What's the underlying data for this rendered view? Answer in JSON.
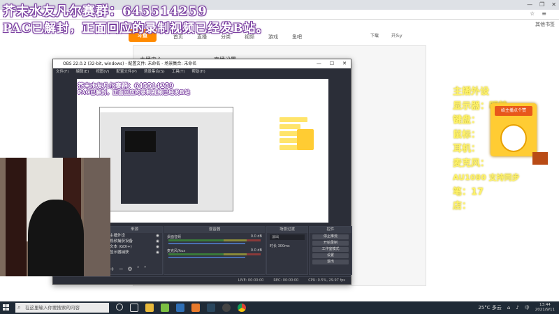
{
  "overlay": {
    "line1": "芥末水友凡尔赛群：645514259",
    "line2": "PAC已解封，正面回应的录制视频已经发B站。"
  },
  "browser": {
    "window_controls": [
      "—",
      "❐",
      "✕"
    ],
    "addr_icons": [
      "☆",
      "≡"
    ],
    "bookmarks_label": "其他书签",
    "site_logo": "斗鱼",
    "nav": [
      "首页",
      "直播",
      "分类",
      "视频",
      "游戏",
      "鱼吧"
    ],
    "nav_right": [
      "下载",
      "开头y"
    ],
    "panel_title": "主播中心",
    "panel_title2": "直播设置"
  },
  "info": {
    "lines": [
      "主播外设",
      "显示器：明基",
      "键盘：",
      "鼠标：",
      "耳机：",
      "麦克风：",
      "AU1080  支持同步",
      "笔：17",
      "店："
    ],
    "badge_caption": "给主播点个赞"
  },
  "obs": {
    "title": "OBS 22.0.2 (32-bit, windows) - 配置文件: 未命名 - 场景集合: 未命名",
    "title_controls": [
      "—",
      "☐",
      "✕"
    ],
    "menu": [
      "文件(F)",
      "编辑(E)",
      "视图(V)",
      "配置文件(P)",
      "场景集合(S)",
      "工具(T)",
      "帮助(H)"
    ],
    "preview_line1": "芥末水友凡尔赛群：645514259",
    "preview_line2": "PAC已解封，正面回应的录制视频已经发B站",
    "docks": {
      "scenes": "场景",
      "sources": "来源",
      "mixer": "混音器",
      "transitions": "场景过渡",
      "controls": "控件"
    },
    "sources": [
      "主播外设",
      "视频捕获设备",
      "文本 (GDI+)",
      "显示器捕获"
    ],
    "mixer": [
      {
        "name": "桌面音频",
        "level": "0.0 dB"
      },
      {
        "name": "麦克风/Aux",
        "level": "0.0 dB"
      }
    ],
    "transition": "淡出",
    "duration_label": "时长",
    "duration": "300ms",
    "controls": [
      "停止推流",
      "开始录制",
      "工作室模式",
      "设置",
      "退出"
    ],
    "status": [
      "LIVE: 00:00:00",
      "REC: 00:00:00",
      "CPU: 0.5%, 29.97 fps"
    ]
  },
  "taskbar": {
    "search_placeholder": "在这里输入你要搜索的内容",
    "weather": "25°C 多云",
    "time": "13:44",
    "date": "2021/9/11",
    "lang": "中"
  }
}
